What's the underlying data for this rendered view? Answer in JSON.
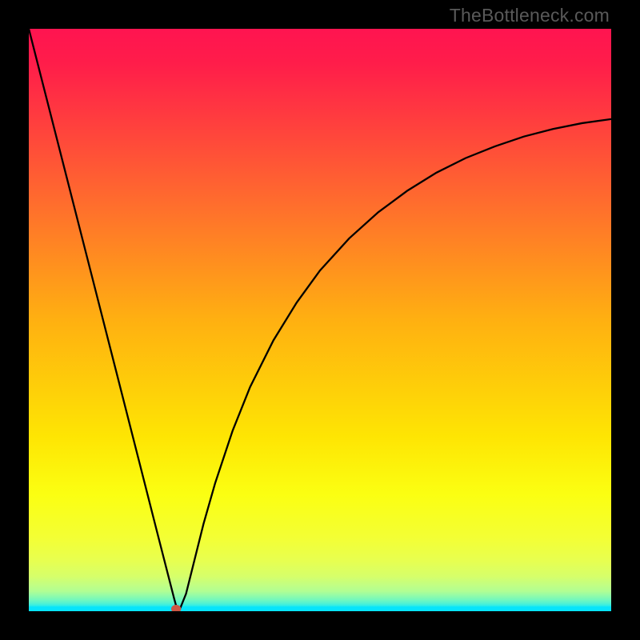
{
  "attribution": "TheBottleneck.com",
  "colors": {
    "stops": [
      {
        "pos": 0.0,
        "hex": "#ff1450"
      },
      {
        "pos": 0.06,
        "hex": "#ff1d4a"
      },
      {
        "pos": 0.3,
        "hex": "#ff6d2d"
      },
      {
        "pos": 0.5,
        "hex": "#ffb011"
      },
      {
        "pos": 0.7,
        "hex": "#fee503"
      },
      {
        "pos": 0.8,
        "hex": "#fbff12"
      },
      {
        "pos": 0.875,
        "hex": "#f3ff35"
      },
      {
        "pos": 0.912,
        "hex": "#e8ff4f"
      },
      {
        "pos": 0.94,
        "hex": "#d6ff6a"
      },
      {
        "pos": 0.956,
        "hex": "#c0fe85"
      },
      {
        "pos": 0.966,
        "hex": "#b0fe94"
      },
      {
        "pos": 0.974,
        "hex": "#8ffbab"
      },
      {
        "pos": 0.98,
        "hex": "#75f8bc"
      },
      {
        "pos": 0.986,
        "hex": "#55f3d0"
      },
      {
        "pos": 0.99,
        "hex": "#35ede3"
      },
      {
        "pos": 0.993,
        "hex": "#07e4fb"
      },
      {
        "pos": 1.0,
        "hex": "#07e4fb"
      }
    ],
    "curve_stroke": "#000000",
    "marker_fill": "#cd5745",
    "frame_bg": "#000000"
  },
  "chart_data": {
    "type": "line",
    "title": "",
    "xlabel": "",
    "ylabel": "",
    "xlim": [
      0,
      100
    ],
    "ylim": [
      0,
      100
    ],
    "series": [
      {
        "name": "bottleneck-curve",
        "x": [
          0,
          5,
          10,
          15,
          19,
          22,
          24,
          25,
          25.5,
          26,
          27,
          28,
          30,
          32,
          35,
          38,
          42,
          46,
          50,
          55,
          60,
          65,
          70,
          75,
          80,
          85,
          90,
          95,
          100
        ],
        "y": [
          100,
          80.4,
          60.8,
          41.2,
          25.5,
          13.7,
          5.9,
          2.0,
          0.2,
          0.5,
          3.0,
          7.0,
          15.0,
          22.0,
          31.0,
          38.5,
          46.5,
          53.0,
          58.5,
          64.0,
          68.5,
          72.2,
          75.3,
          77.8,
          79.8,
          81.5,
          82.8,
          83.8,
          84.5
        ]
      }
    ],
    "marker": {
      "x": 25.3,
      "y": 0.4
    }
  }
}
